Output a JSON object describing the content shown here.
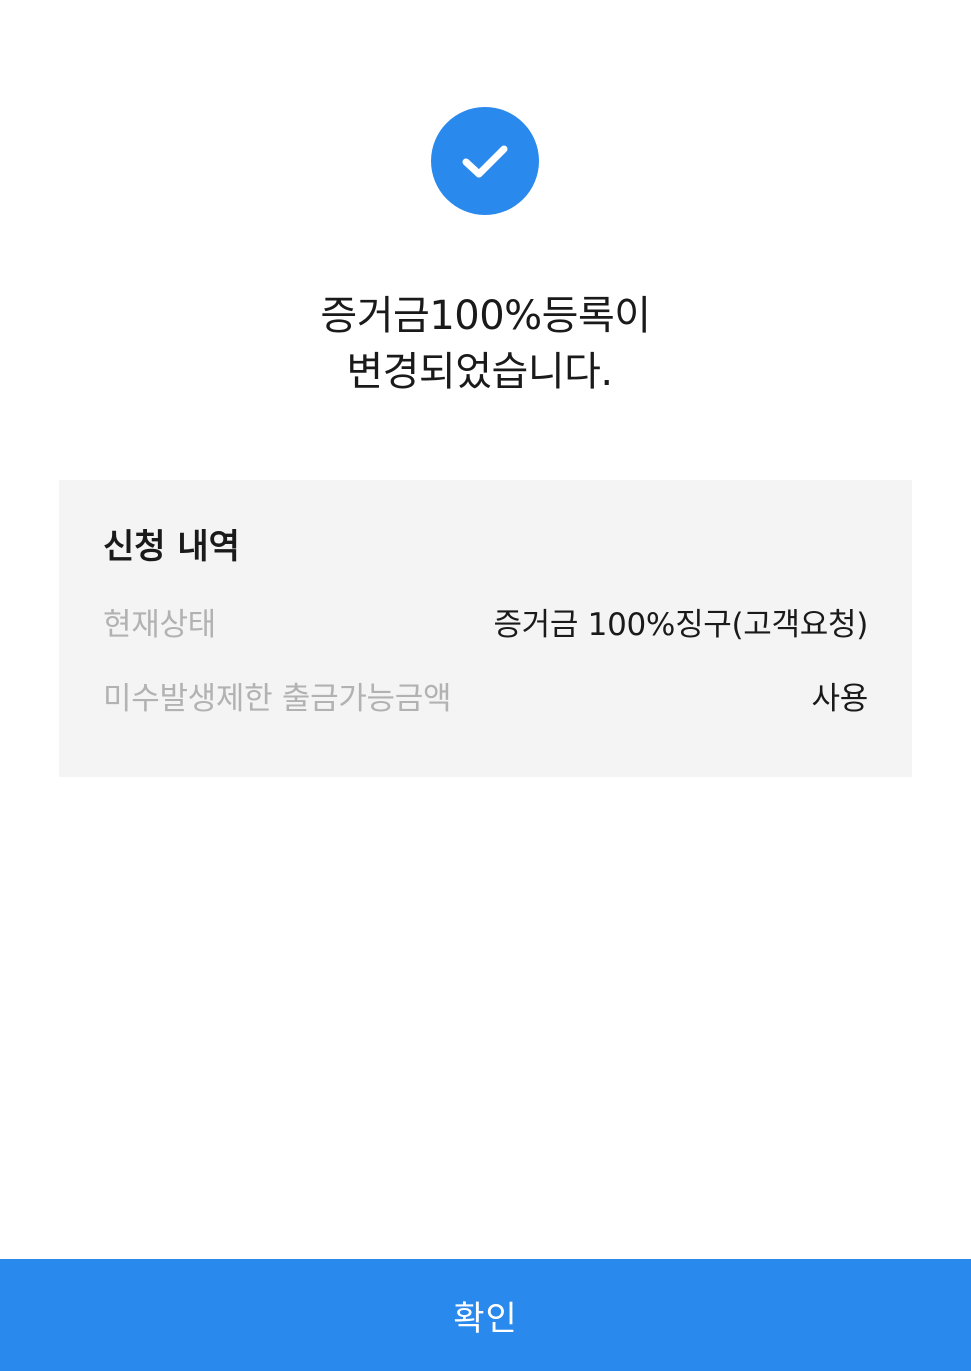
{
  "colors": {
    "accent": "#2a89ec",
    "card_bg": "#f4f4f4",
    "label_gray": "#b2b2b2"
  },
  "status_icon": "check-icon",
  "headline": {
    "line1": "증거금100%등록이",
    "line2": "변경되었습니다."
  },
  "details": {
    "title": "신청 내역",
    "rows": [
      {
        "label": "현재상태",
        "value": "증거금 100%징구(고객요청)"
      },
      {
        "label": "미수발생제한 출금가능금액",
        "value": "사용"
      }
    ]
  },
  "footer": {
    "confirm_label": "확인"
  }
}
